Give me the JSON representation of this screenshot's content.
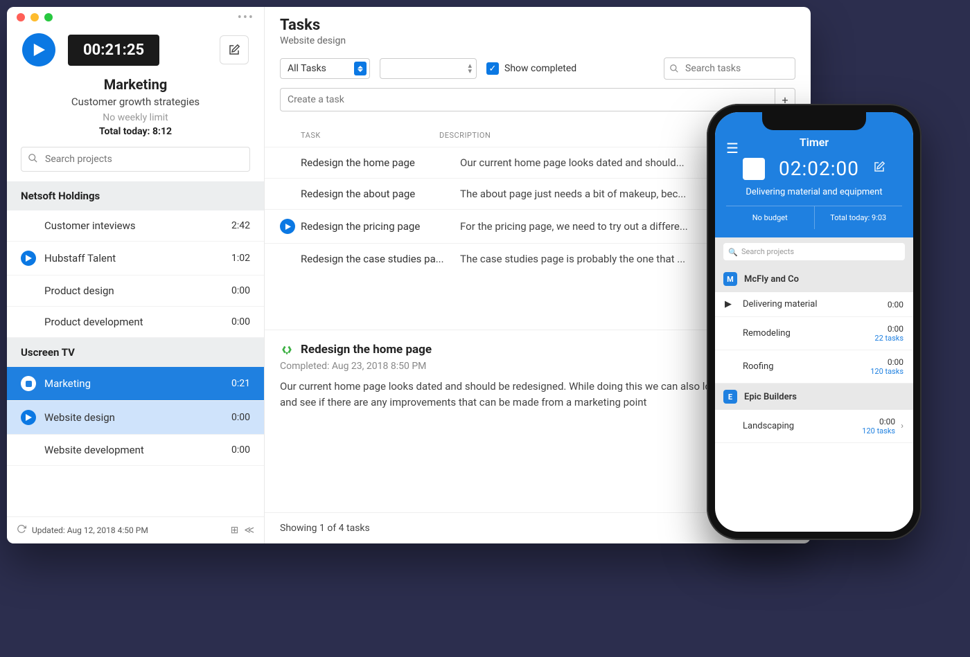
{
  "desktop": {
    "sidebar": {
      "timer": "00:21:25",
      "project_title": "Marketing",
      "project_sub": "Customer growth strategies",
      "no_limit": "No weekly limit",
      "total_today": "Total today: 8:12",
      "search_placeholder": "Search projects",
      "groups": [
        {
          "name": "Netsoft Holdings",
          "items": [
            {
              "name": "Customer inteviews",
              "time": "2:42",
              "play": false
            },
            {
              "name": "Hubstaff Talent",
              "time": "1:02",
              "play": true
            },
            {
              "name": "Product design",
              "time": "0:00",
              "play": false
            },
            {
              "name": "Product development",
              "time": "0:00",
              "play": false
            }
          ]
        },
        {
          "name": "Uscreen TV",
          "items": [
            {
              "name": "Marketing",
              "time": "0:21",
              "play": false,
              "selected": true,
              "stop": true
            },
            {
              "name": "Website design",
              "time": "0:00",
              "play": true,
              "sub": true
            },
            {
              "name": "Website development",
              "time": "0:00",
              "play": false
            }
          ]
        }
      ],
      "footer": {
        "updated": "Updated: Aug 12, 2018 4:50 PM"
      }
    },
    "main": {
      "title": "Tasks",
      "sub": "Website design",
      "filter_tasks": "All Tasks",
      "show_completed": "Show completed",
      "search_placeholder": "Search tasks",
      "create_placeholder": "Create a task",
      "head_task": "TASK",
      "head_desc": "DESCRIPTION",
      "tasks": [
        {
          "name": "Redesign the home page",
          "desc": "Our current home page looks dated and should...",
          "playing": false
        },
        {
          "name": "Redesign the about page",
          "desc": "The about page just needs a bit of makeup, bec...",
          "playing": false
        },
        {
          "name": "Redesign the pricing page",
          "desc": "For the pricing page, we need to try out a differe...",
          "playing": true
        },
        {
          "name": "Redesign the case studies pa...",
          "desc": "The case studies page is probably the one that ...",
          "playing": false
        }
      ],
      "detail": {
        "title": "Redesign the home page",
        "completed": "Completed: Aug 23, 2018 8:50 PM",
        "body": "Our current home page looks dated and should be redesigned. While doing this we can also look at each section and see if there are any improvements that can be made from a marketing point"
      },
      "footer": "Showing 1 of 4 tasks"
    }
  },
  "phone": {
    "title": "Timer",
    "timer": "02:02:00",
    "task": "Delivering material and equipment",
    "stat_left": "No budget",
    "stat_right": "Total today: 9:03",
    "search_placeholder": "Search projects",
    "groups": [
      {
        "badge": "M",
        "name": "McFly and Co",
        "items": [
          {
            "name": "Delivering material",
            "time": "0:00",
            "tasks": "",
            "play": true
          },
          {
            "name": "Remodeling",
            "time": "0:00",
            "tasks": "22 tasks",
            "play": false
          },
          {
            "name": "Roofing",
            "time": "0:00",
            "tasks": "120 tasks",
            "play": false
          }
        ]
      },
      {
        "badge": "E",
        "name": "Epic Builders",
        "items": [
          {
            "name": "Landscaping",
            "time": "0:00",
            "tasks": "120 tasks",
            "play": false,
            "chevron": true
          }
        ]
      }
    ]
  }
}
